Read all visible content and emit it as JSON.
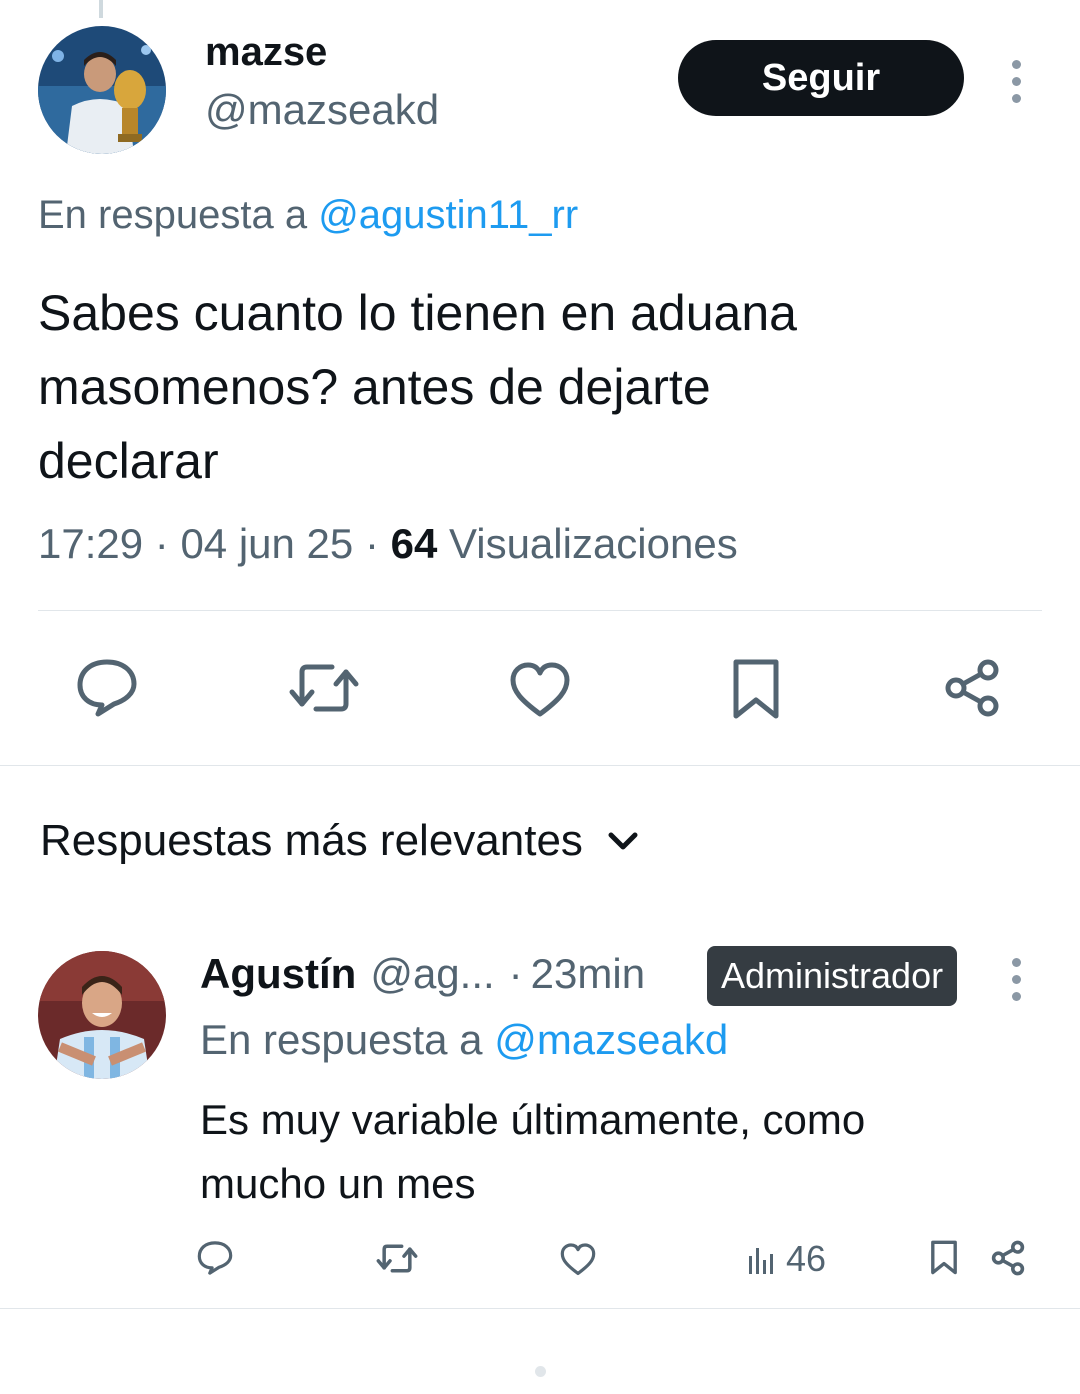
{
  "main_tweet": {
    "display_name": "mazse",
    "handle": "@mazseakd",
    "follow_label": "Seguir",
    "reply_prefix": "En respuesta a",
    "reply_handle": "@agustin11_rr",
    "text_lines": [
      "Sabes cuanto lo tienen en aduana",
      "masomenos?  antes de dejarte",
      "declarar"
    ],
    "time": "17:29",
    "date": "04 jun 25",
    "views_count": "64",
    "views_label": "Visualizaciones",
    "icons": [
      "reply-icon",
      "retweet-icon",
      "like-icon",
      "bookmark-icon",
      "share-icon"
    ]
  },
  "replies_header": {
    "label": "Respuestas más relevantes"
  },
  "reply": {
    "display_name": "Agustín",
    "handle": "@ag...",
    "time": "23min",
    "badge": "Administrador",
    "reply_prefix": "En respuesta a",
    "reply_handle": "@mazseakd",
    "text_lines": [
      "Es muy variable últimamente, como",
      "mucho un mes"
    ],
    "views": "46",
    "icons": [
      "reply-icon",
      "retweet-icon",
      "like-icon",
      "views-icon",
      "bookmark-icon",
      "share-icon"
    ]
  },
  "colors": {
    "text": "#0f1419",
    "muted": "#536471",
    "link": "#1d9bf0",
    "follow_bg": "#0f1419",
    "badge_bg": "#353c42"
  }
}
